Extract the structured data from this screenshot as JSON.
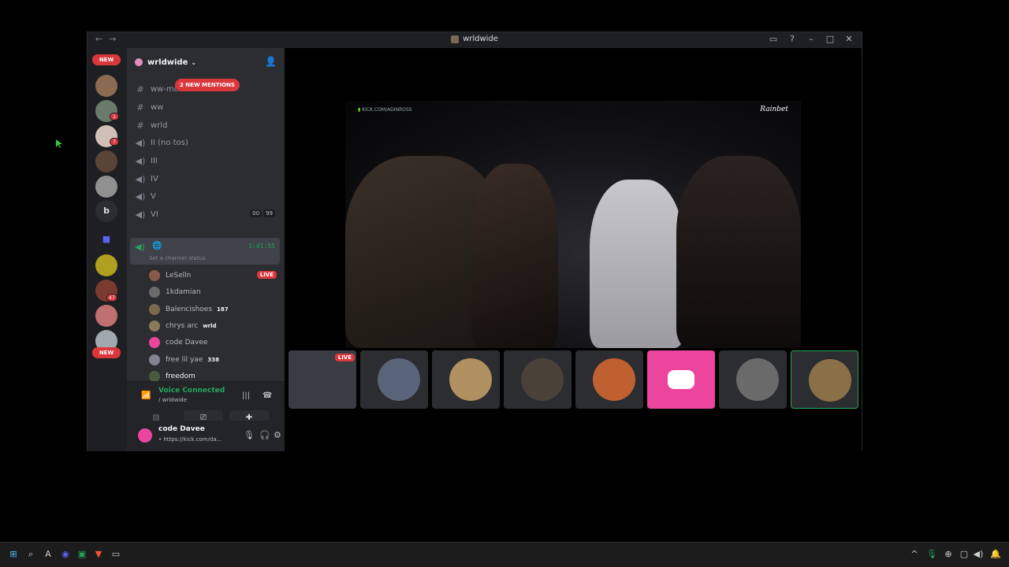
{
  "window": {
    "title": "wrldwide",
    "back_icon": "arrow-left-icon",
    "forward_icon": "arrow-right-icon",
    "controls": [
      "inbox-icon",
      "help-icon",
      "minimize-icon",
      "maximize-icon",
      "close-icon"
    ]
  },
  "guilds": {
    "new_top": "NEW",
    "new_bottom": "NEW",
    "badges": [
      "1",
      "7",
      "47"
    ],
    "letter": "b"
  },
  "server": {
    "name": "wrldwide",
    "mentions_pill": "2 NEW MENTIONS"
  },
  "channels": [
    {
      "icon": "#",
      "name": "ww-mo"
    },
    {
      "icon": "#",
      "name": "ww"
    },
    {
      "icon": "#",
      "name": "wrld"
    },
    {
      "icon": "speaker",
      "name": "II (no tos)"
    },
    {
      "icon": "speaker",
      "name": "III"
    },
    {
      "icon": "speaker",
      "name": "IV"
    },
    {
      "icon": "speaker",
      "name": "V"
    },
    {
      "icon": "speaker",
      "name": "VI",
      "counts": [
        "00",
        "99"
      ]
    }
  ],
  "active_voice": {
    "timer": "1:41:55",
    "status_placeholder": "Set a channel status"
  },
  "members": [
    {
      "name": "LeSelln",
      "live": "LIVE",
      "color": "#8a5a48"
    },
    {
      "name": "1kdamian",
      "color": "#6a6a6a"
    },
    {
      "name": "Balencishoes",
      "tag": "187",
      "color": "#7a6a4a"
    },
    {
      "name": "chrys arc",
      "tag": "wrld",
      "color": "#8a7a5a"
    },
    {
      "name": "code Davee",
      "color": "#eb459e"
    },
    {
      "name": "free lil yae",
      "tag": "338",
      "color": "#80848e"
    },
    {
      "name": "freedom",
      "color": "#4a5a3a"
    }
  ],
  "voice_bar": {
    "title": "Voice Connected",
    "subtitle": "/ wrldwide"
  },
  "user": {
    "name": "code Davee",
    "status": "• https://kick.com/da..."
  },
  "stream": {
    "overlay_text": "KICK.COM/ADINROSS",
    "brand": "Rainbet"
  },
  "tiles": [
    {
      "live": "LIVE",
      "color": "#3a3c44"
    },
    {
      "color": "#5a6478"
    },
    {
      "color": "#b09060"
    },
    {
      "color": "#4a4238"
    },
    {
      "color": "#c06030"
    },
    {
      "color": "#eb459e"
    },
    {
      "color": "#6a6a6a"
    },
    {
      "color": "#8a7048"
    }
  ],
  "taskbar": {
    "left_icons": [
      "start-icon",
      "search-icon",
      "app-a-icon",
      "discord-icon",
      "app-green-icon",
      "brave-icon",
      "app-gray-icon"
    ],
    "right_icons": [
      "chevron-up-icon",
      "mic-icon",
      "wifi-icon",
      "display-icon",
      "volume-icon",
      "notification-icon"
    ]
  }
}
